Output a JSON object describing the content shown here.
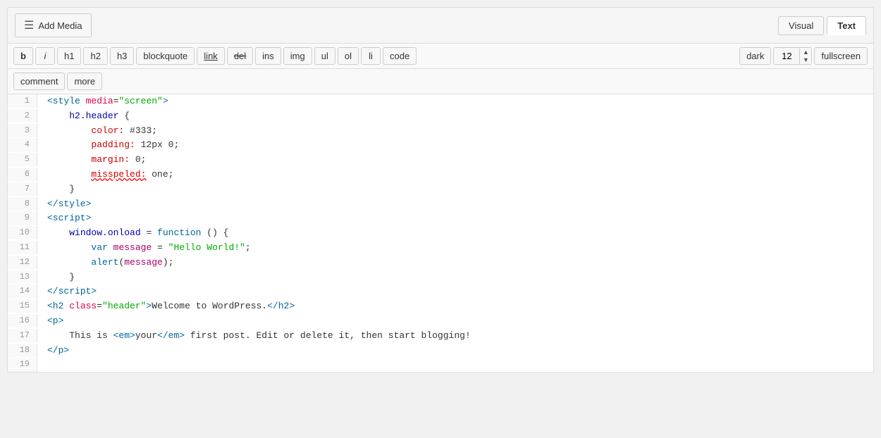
{
  "topBar": {
    "addMediaLabel": "Add Media",
    "viewTabs": [
      {
        "id": "visual",
        "label": "Visual"
      },
      {
        "id": "text",
        "label": "Text",
        "active": true
      }
    ]
  },
  "toolbar": {
    "buttons": [
      {
        "id": "bold",
        "label": "b",
        "style": "bold"
      },
      {
        "id": "italic",
        "label": "i",
        "style": "italic"
      },
      {
        "id": "h1",
        "label": "h1"
      },
      {
        "id": "h2",
        "label": "h2"
      },
      {
        "id": "h3",
        "label": "h3"
      },
      {
        "id": "blockquote",
        "label": "blockquote"
      },
      {
        "id": "link",
        "label": "link",
        "style": "link"
      },
      {
        "id": "del",
        "label": "del",
        "style": "strike"
      },
      {
        "id": "ins",
        "label": "ins"
      },
      {
        "id": "img",
        "label": "img"
      },
      {
        "id": "ul",
        "label": "ul"
      },
      {
        "id": "ol",
        "label": "ol"
      },
      {
        "id": "li",
        "label": "li"
      },
      {
        "id": "code",
        "label": "code"
      }
    ],
    "right": {
      "themeLabel": "dark",
      "fontSize": "12",
      "fullscreenLabel": "fullscreen"
    }
  },
  "toolbar2": {
    "buttons": [
      {
        "id": "comment",
        "label": "comment"
      },
      {
        "id": "more",
        "label": "more"
      }
    ]
  },
  "code": {
    "lines": [
      {
        "num": 1,
        "raw": true,
        "html": "<span class='tag'>&lt;style</span> <span class='attr-name'>media</span>=<span class='attr-value'>\"screen\"</span><span class='tag'>&gt;</span>"
      },
      {
        "num": 2,
        "raw": true,
        "html": "    <span class='selector'>h2.header</span> {"
      },
      {
        "num": 3,
        "raw": true,
        "html": "        <span class='property'>color:</span> <span class='value'>#333;</span>"
      },
      {
        "num": 4,
        "raw": true,
        "html": "        <span class='property'>padding:</span> <span class='value'>12px 0;</span>"
      },
      {
        "num": 5,
        "raw": true,
        "html": "        <span class='property'>margin:</span> <span class='value'>0;</span>"
      },
      {
        "num": 6,
        "raw": true,
        "html": "        <span class='error-prop'>misspeled:</span> <span class='value'>one;</span>"
      },
      {
        "num": 7,
        "raw": true,
        "html": "    }"
      },
      {
        "num": 8,
        "raw": true,
        "html": "<span class='tag'>&lt;/style&gt;</span>"
      },
      {
        "num": 9,
        "raw": true,
        "html": "<span class='tag'>&lt;script&gt;</span>"
      },
      {
        "num": 10,
        "raw": true,
        "html": "    <span class='selector'>window.onload</span> = <span class='keyword'>function</span> () {"
      },
      {
        "num": 11,
        "raw": true,
        "html": "        <span class='keyword'>var</span> <span class='var-name'>message</span> = <span class='str-lit'>\"Hello World!\"</span>;"
      },
      {
        "num": 12,
        "raw": true,
        "html": "        <span class='func-name'>alert</span>(<span class='var-name'>message</span>);"
      },
      {
        "num": 13,
        "raw": true,
        "html": "    }"
      },
      {
        "num": 14,
        "raw": true,
        "html": "<span class='tag'>&lt;/script&gt;</span>"
      },
      {
        "num": 15,
        "raw": true,
        "html": "<span class='tag'>&lt;h2</span> <span class='attr-name'>class</span>=<span class='attr-value'>\"header\"</span><span class='tag'>&gt;</span>Welcome to WordPress.<span class='tag'>&lt;/h2&gt;</span>"
      },
      {
        "num": 16,
        "raw": true,
        "html": "<span class='tag'>&lt;p&gt;</span>"
      },
      {
        "num": 17,
        "raw": true,
        "html": "    This is <span class='tag'>&lt;em&gt;</span>your<span class='tag'>&lt;/em&gt;</span> first post. Edit or delete it, then start blogging!"
      },
      {
        "num": 18,
        "raw": true,
        "html": "<span class='tag'>&lt;/p&gt;</span>"
      },
      {
        "num": 19,
        "raw": true,
        "html": ""
      }
    ]
  }
}
